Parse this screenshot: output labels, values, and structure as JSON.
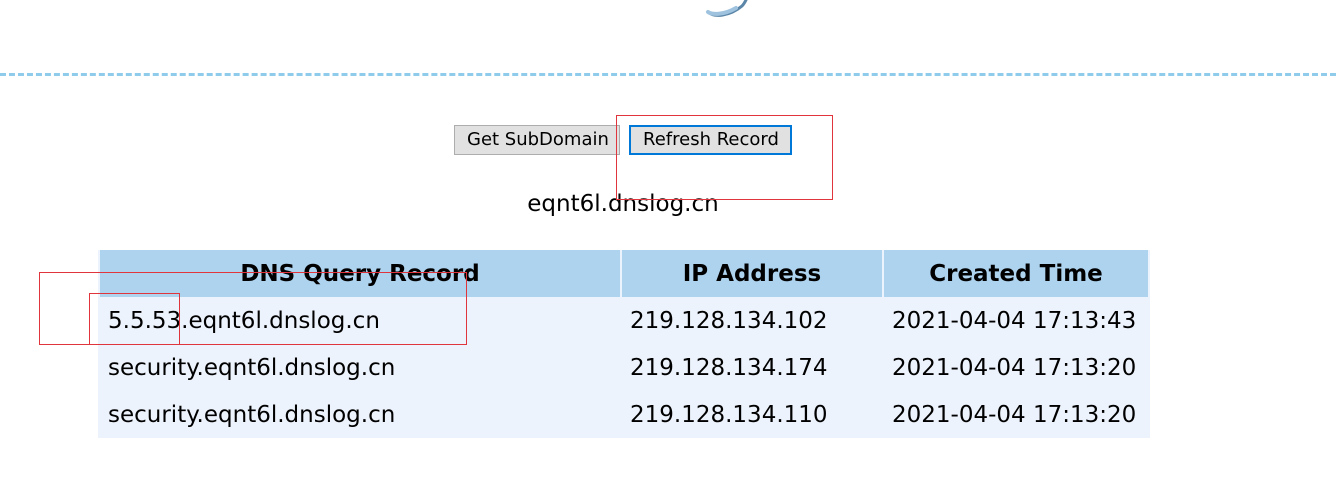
{
  "header": {
    "logo_icon": "dnslog-logo-fragment-icon"
  },
  "controls": {
    "get_subdomain_label": "Get SubDomain",
    "refresh_record_label": "Refresh Record"
  },
  "subdomain": "eqnt6l.dnslog.cn",
  "records_table": {
    "columns": [
      "DNS Query Record",
      "IP Address",
      "Created Time"
    ],
    "rows": [
      [
        "5.5.53.eqnt6l.dnslog.cn",
        "219.128.134.102",
        "2021-04-04 17:13:43"
      ],
      [
        "security.eqnt6l.dnslog.cn",
        "219.128.134.174",
        "2021-04-04 17:13:20"
      ],
      [
        "security.eqnt6l.dnslog.cn",
        "219.128.134.110",
        "2021-04-04 17:13:20"
      ]
    ]
  },
  "colors": {
    "divider": "#8fcbeb",
    "table_header_bg": "#aed3ef",
    "table_body_bg": "#edf3fc",
    "annotation": "#e0353d",
    "focus_border": "#0078d7"
  }
}
